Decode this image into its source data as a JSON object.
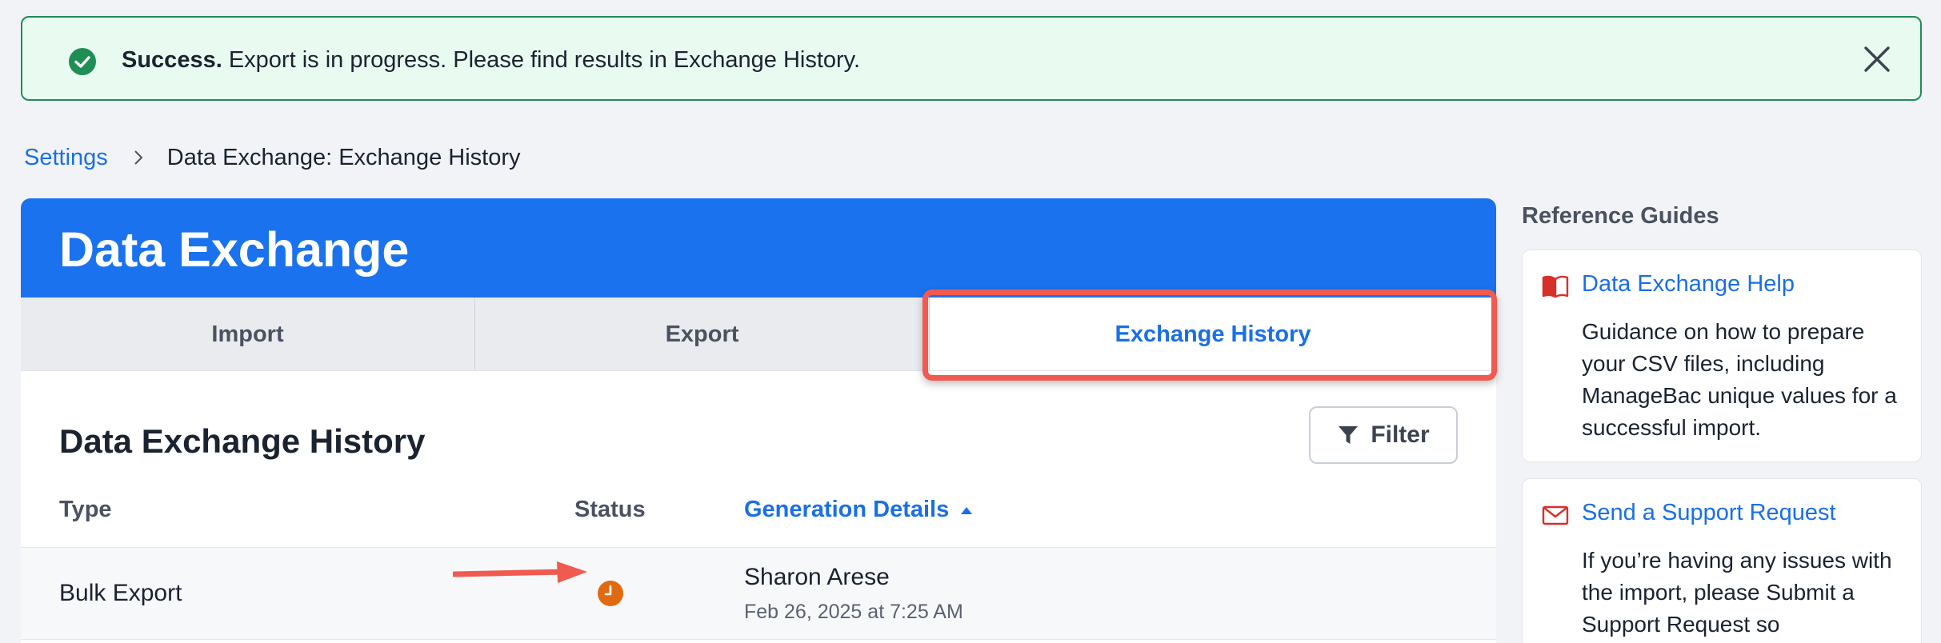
{
  "banner": {
    "strong": "Success.",
    "message": "Export is in progress. Please find results in Exchange History."
  },
  "breadcrumb": {
    "root": "Settings",
    "current": "Data Exchange: Exchange History"
  },
  "header": {
    "title": "Data Exchange"
  },
  "tabs": [
    {
      "label": "Import"
    },
    {
      "label": "Export"
    },
    {
      "label": "Exchange History"
    }
  ],
  "history": {
    "title": "Data Exchange History",
    "filter_label": "Filter",
    "columns": {
      "type": "Type",
      "status": "Status",
      "generation": "Generation Details"
    },
    "rows": [
      {
        "type": "Bulk Export",
        "status": "in-progress-clock-icon",
        "name": "Sharon Arese",
        "date": "Feb 26, 2025 at 7:25 AM"
      }
    ]
  },
  "sidebar": {
    "title": "Reference Guides",
    "guides": [
      {
        "icon": "book-icon",
        "link": "Data Exchange Help",
        "text": "Guidance on how to prepare your CSV files, including ManageBac unique values for a successful import."
      },
      {
        "icon": "envelope-icon",
        "link": "Send a Support Request",
        "text": "If you’re having any issues with the import, please Submit a Support Request so"
      }
    ]
  },
  "colors": {
    "accent": "#1a72ee",
    "success": "#1f8e55",
    "highlight": "#f05a4f",
    "status_pending": "#e06a12"
  }
}
